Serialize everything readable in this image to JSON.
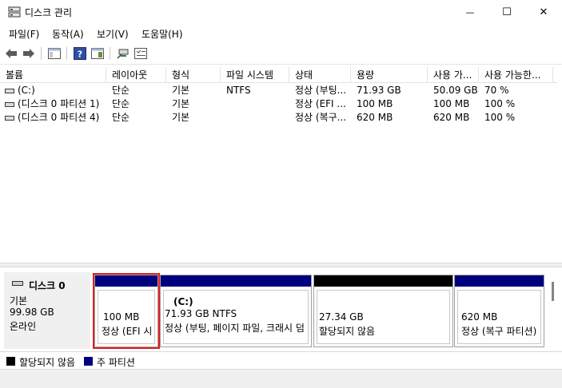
{
  "window": {
    "title": "디스크 관리",
    "controls": {
      "minimize": "—",
      "maximize": "☐",
      "close": "✕"
    }
  },
  "menu": [
    "파일(F)",
    "동작(A)",
    "보기(V)",
    "도움말(H)"
  ],
  "toolbar": {
    "icons": [
      "back-arrow-icon",
      "forward-arrow-icon",
      "console-tree-icon",
      "help-icon",
      "show-pane-icon",
      "connect-icon",
      "properties-icon"
    ]
  },
  "volume_list": {
    "columns": [
      "볼륨",
      "레이아웃",
      "형식",
      "파일 시스템",
      "상태",
      "용량",
      "사용 가...",
      "사용 가능한..."
    ],
    "rows": [
      {
        "volume": "(C:)",
        "layout": "단순",
        "type": "기본",
        "fs": "NTFS",
        "status": "정상 (부팅...",
        "capacity": "71.93 GB",
        "free": "50.09 GB",
        "free_pct": "70 %"
      },
      {
        "volume": "(디스크 0 파티션 1)",
        "layout": "단순",
        "type": "기본",
        "fs": "",
        "status": "정상 (EFI ...",
        "capacity": "100 MB",
        "free": "100 MB",
        "free_pct": "100 %"
      },
      {
        "volume": "(디스크 0 파티션 4)",
        "layout": "단순",
        "type": "기본",
        "fs": "",
        "status": "정상 (복구...",
        "capacity": "620 MB",
        "free": "620 MB",
        "free_pct": "100 %"
      }
    ]
  },
  "disk_map": {
    "disk": {
      "name": "디스크 0",
      "type": "기본",
      "size": "99.98 GB",
      "state": "온라인"
    },
    "partitions": [
      {
        "label": "",
        "size": "100 MB",
        "status": "정상 (EFI 시",
        "kind": "primary"
      },
      {
        "label": "(C:)",
        "size": "71.93 GB NTFS",
        "status": "정상 (부팅, 페이지 파일, 크래시 덤",
        "kind": "primary"
      },
      {
        "label": "",
        "size": "27.34 GB",
        "status": "할당되지 않음",
        "kind": "unallocated"
      },
      {
        "label": "",
        "size": "620 MB",
        "status": "정상 (복구 파티션)",
        "kind": "primary"
      }
    ]
  },
  "legend": [
    {
      "label": "할당되지 않음",
      "color": "#000000"
    },
    {
      "label": "주 파티션",
      "color": "#00007f"
    }
  ],
  "colors": {
    "primary": "#00007f",
    "unallocated": "#000000",
    "selection_outline": "#e01f1f"
  }
}
